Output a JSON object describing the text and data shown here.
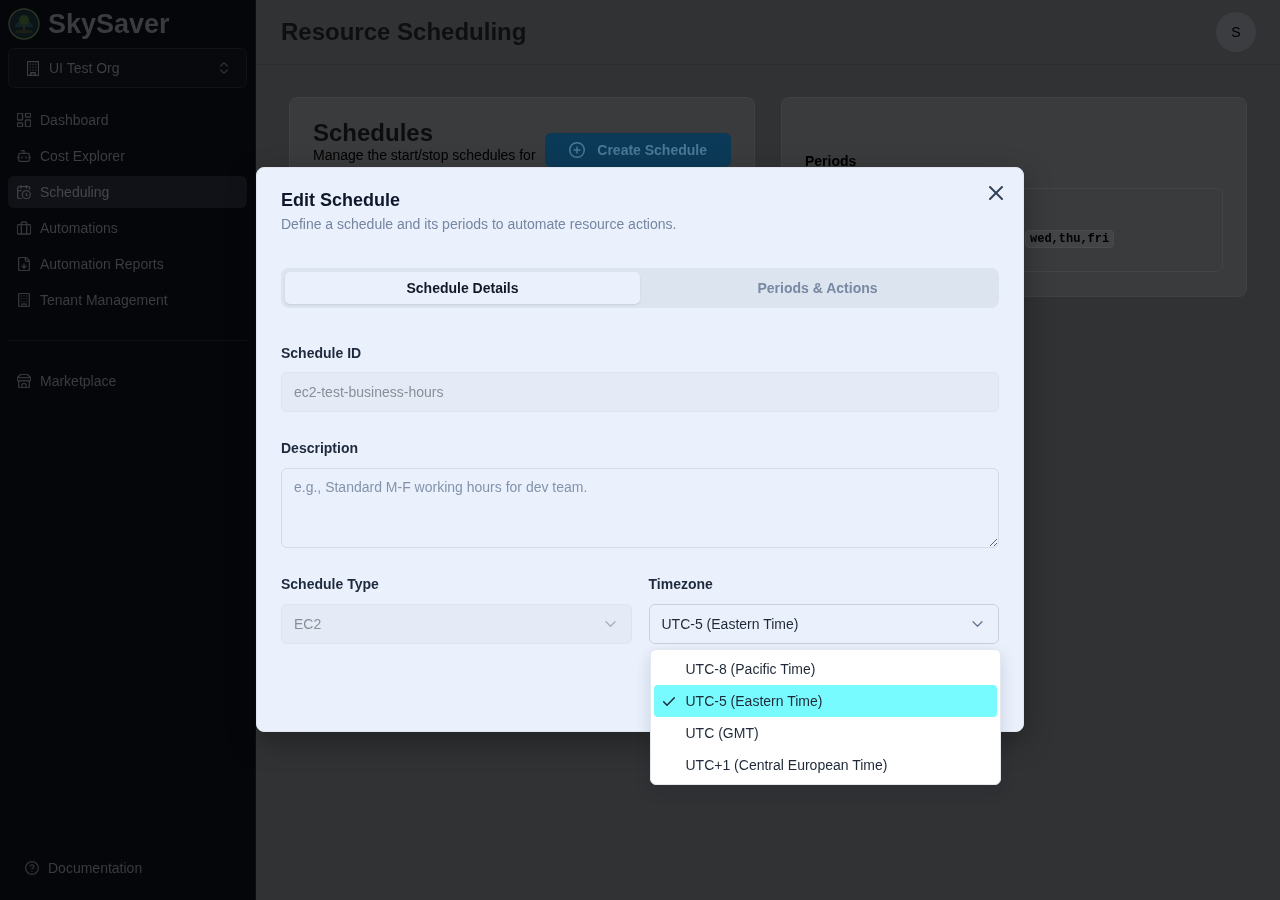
{
  "sidebar": {
    "brand": "SkySaver",
    "org_selector": {
      "label": "UI Test Org"
    },
    "nav_items": [
      {
        "label": "Dashboard",
        "selected": false
      },
      {
        "label": "Cost Explorer",
        "selected": false
      },
      {
        "label": "Scheduling",
        "selected": true
      },
      {
        "label": "Automations",
        "selected": false
      },
      {
        "label": "Automation Reports",
        "selected": false
      },
      {
        "label": "Tenant Management",
        "selected": false
      }
    ],
    "secondary_items": [
      {
        "label": "Marketplace",
        "selected": false
      }
    ],
    "footer_link": {
      "label": "Documentation"
    }
  },
  "header": {
    "title": "Resource Scheduling",
    "avatar": "S"
  },
  "schedules_card": {
    "title": "Schedules",
    "subtitle": "Manage the start/stop schedules for",
    "button": "Create Schedule"
  },
  "periods_card": {
    "title": "Periods",
    "days": "wed,thu,fri"
  },
  "modal": {
    "title": "Edit Schedule",
    "subtitle": "Define a schedule and its periods to automate resource actions.",
    "tabs": [
      {
        "label": "Schedule Details",
        "selected": true
      },
      {
        "label": "Periods & Actions",
        "selected": false
      }
    ],
    "fields": [
      {
        "kind": "input",
        "label": "Schedule ID",
        "value": "ec2-test-business-hours",
        "disabled": true
      },
      {
        "kind": "textarea",
        "label": "Description",
        "placeholder": "e.g., Standard M-F working hours for dev team.",
        "disabled": false
      }
    ],
    "selects": [
      {
        "label": "Schedule Type",
        "value": "EC2",
        "disabled": true,
        "expanded": false
      },
      {
        "label": "Timezone",
        "value": "UTC-5 (Eastern Time)",
        "disabled": false,
        "expanded": true,
        "options": [
          {
            "label": "UTC-8 (Pacific Time)",
            "selected": false
          },
          {
            "label": "UTC-5 (Eastern Time)",
            "selected": true
          },
          {
            "label": "UTC (GMT)",
            "selected": false
          },
          {
            "label": "UTC+1 (Central European Time)",
            "selected": false
          }
        ]
      }
    ]
  }
}
